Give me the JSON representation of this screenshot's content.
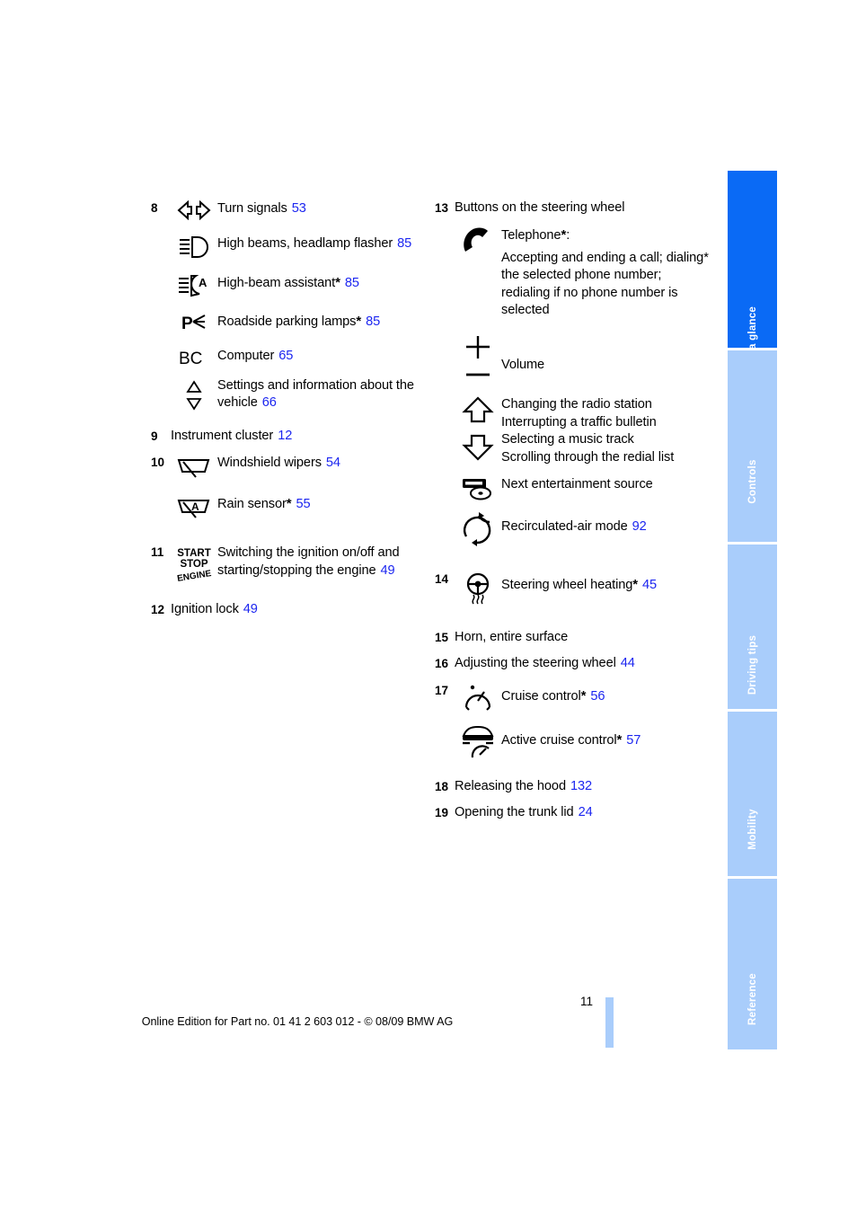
{
  "page": {
    "folio": "11",
    "footer": "Online Edition for Part no. 01 41 2 603 012 - © 08/09 BMW AG",
    "accent_blue": "#1c26f0",
    "tab_active_color": "#0a6af5",
    "tab_inactive_color": "#a9cdfb"
  },
  "tabs": [
    {
      "label": "At a glance",
      "active": true
    },
    {
      "label": "Controls",
      "active": false
    },
    {
      "label": "Driving tips",
      "active": false
    },
    {
      "label": "Mobility",
      "active": false
    },
    {
      "label": "Reference",
      "active": false
    }
  ],
  "left_column": {
    "item8": {
      "number": "8",
      "rows": [
        {
          "icon": "turn-signals-icon",
          "text": "Turn signals",
          "page": "53"
        },
        {
          "icon": "high-beams-icon",
          "text": "High beams, headlamp flasher",
          "page": "85"
        },
        {
          "icon": "high-beam-assistant-icon",
          "text": "High-beam assistant",
          "star": "*",
          "page": "85"
        },
        {
          "icon": "roadside-parking-lamps-icon",
          "text": "Roadside parking lamps",
          "star": "*",
          "page": "85"
        },
        {
          "icon": "onboard-computer-icon",
          "text": "Computer",
          "page": "65"
        },
        {
          "icon": "up-down-triangles-icon",
          "text": "Settings and information about the vehicle",
          "page": "66"
        }
      ]
    },
    "item9": {
      "number": "9",
      "text": "Instrument cluster",
      "page": "12"
    },
    "item10": {
      "number": "10",
      "rows": [
        {
          "icon": "windshield-wipers-icon",
          "text": "Windshield wipers",
          "page": "54"
        },
        {
          "icon": "rain-sensor-icon",
          "text": "Rain sensor",
          "star": "*",
          "page": "55"
        }
      ]
    },
    "item11": {
      "number": "11",
      "icon": "start-stop-engine-icon",
      "text": "Switching the ignition on/off and starting/stopping the engine",
      "page": "49"
    },
    "item12": {
      "number": "12",
      "text": "Ignition lock",
      "page": "49"
    }
  },
  "right_column": {
    "item13": {
      "number": "13",
      "heading": "Buttons on the steering wheel",
      "rows": [
        {
          "icon": "telephone-handset-icon",
          "title": "Telephone",
          "star": "*",
          "title_suffix": ":",
          "body": "Accepting and ending a call; dialing* the selected phone number; redialing if no phone number is selected"
        },
        {
          "icon": "volume-plus-minus-icon",
          "text": "Volume"
        },
        {
          "icon": "up-down-arrows-icon",
          "lines": [
            "Changing the radio station",
            "Interrupting a traffic bulletin",
            "Selecting a music track",
            "Scrolling through the redial list"
          ]
        },
        {
          "icon": "entertainment-source-icon",
          "text": "Next entertainment source"
        },
        {
          "icon": "recirculated-air-icon",
          "text": "Recirculated-air mode",
          "page": "92"
        }
      ]
    },
    "item14": {
      "number": "14",
      "icon": "steering-wheel-heating-icon",
      "text": "Steering wheel heating",
      "star": "*",
      "page": "45"
    },
    "item15": {
      "number": "15",
      "text": "Horn, entire surface"
    },
    "item16": {
      "number": "16",
      "text": "Adjusting the steering wheel",
      "page": "44"
    },
    "item17": {
      "number": "17",
      "rows": [
        {
          "icon": "cruise-control-icon",
          "text": "Cruise control",
          "star": "*",
          "page": "56"
        },
        {
          "icon": "active-cruise-control-icon",
          "text": "Active cruise control",
          "star": "*",
          "page": "57"
        }
      ]
    },
    "item18": {
      "number": "18",
      "text": "Releasing the hood",
      "page": "132"
    },
    "item19": {
      "number": "19",
      "text": "Opening the trunk lid",
      "page": "24"
    }
  }
}
